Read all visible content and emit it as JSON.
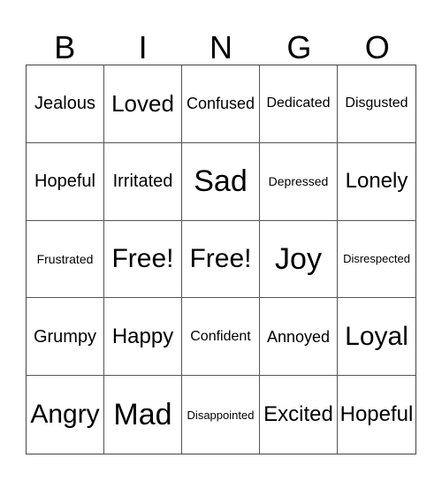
{
  "header": {
    "letters": [
      "B",
      "I",
      "N",
      "G",
      "O"
    ]
  },
  "board": {
    "rows": [
      [
        "Jealous",
        "Loved",
        "Confused",
        "Dedicated",
        "Disgusted"
      ],
      [
        "Hopeful",
        "Irritated",
        "Sad",
        "Depressed",
        "Lonely"
      ],
      [
        "Frustrated",
        "Free!",
        "Free!",
        "Joy",
        "Disrespected"
      ],
      [
        "Grumpy",
        "Happy",
        "Confident",
        "Annoyed",
        "Loyal"
      ],
      [
        "Angry",
        "Mad",
        "Disappointed",
        "Excited",
        "Hopeful"
      ]
    ]
  }
}
